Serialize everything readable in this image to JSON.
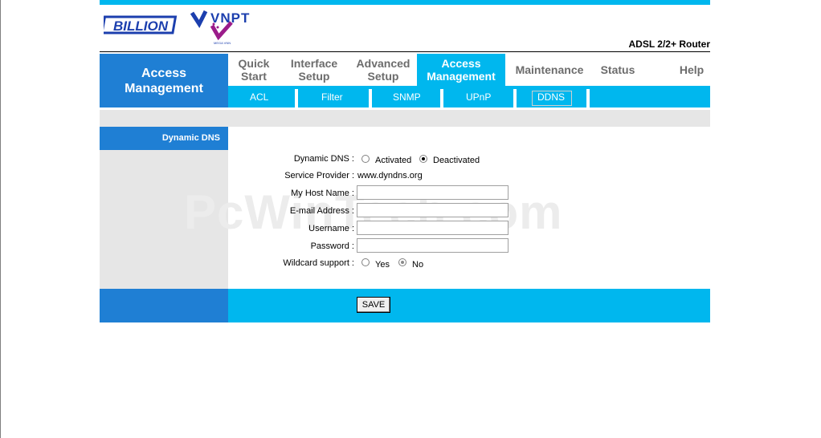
{
  "header": {
    "logo_billion": "BILLION",
    "logo_vnpt": "VNPT",
    "logo_vnpt_sub": "MEGA VNN",
    "router_model": "ADSL 2/2+ Router"
  },
  "section_title": "Access\nManagement",
  "main_tabs": [
    {
      "label": "Quick\nStart",
      "active": false
    },
    {
      "label": "Interface\nSetup",
      "active": false
    },
    {
      "label": "Advanced\nSetup",
      "active": false
    },
    {
      "label": "Access\nManagement",
      "active": true
    },
    {
      "label": "Maintenance",
      "active": false
    },
    {
      "label": "Status",
      "active": false
    },
    {
      "label": "Help",
      "active": false
    }
  ],
  "sub_tabs": [
    {
      "label": "ACL"
    },
    {
      "label": "Filter"
    },
    {
      "label": "SNMP"
    },
    {
      "label": "UPnP"
    },
    {
      "label": "DDNS",
      "active": true
    }
  ],
  "left_nav": {
    "active_item": "Dynamic DNS"
  },
  "watermark": "PcWinTech.com",
  "form": {
    "dynamic_dns_label": "Dynamic DNS :",
    "activated_label": "Activated",
    "deactivated_label": "Deactivated",
    "dynamic_dns_value": "Deactivated",
    "service_provider_label": "Service Provider :",
    "service_provider_value": "www.dyndns.org",
    "host_name_label": "My Host Name :",
    "host_name_value": "",
    "email_label": "E-mail Address :",
    "email_value": "",
    "username_label": "Username :",
    "username_value": "",
    "password_label": "Password :",
    "password_value": "",
    "wildcard_label": "Wildcard support :",
    "yes_label": "Yes",
    "no_label": "No",
    "wildcard_value": "No"
  },
  "save_label": "SAVE",
  "colors": {
    "accent_blue": "#1f7fd4",
    "accent_cyan": "#00b7ee",
    "panel_gray": "#e6e6e6",
    "billion_blue": "#1c3fae",
    "vnpt_blue": "#1c3fae",
    "vnpt_magenta": "#9b1c8a"
  }
}
